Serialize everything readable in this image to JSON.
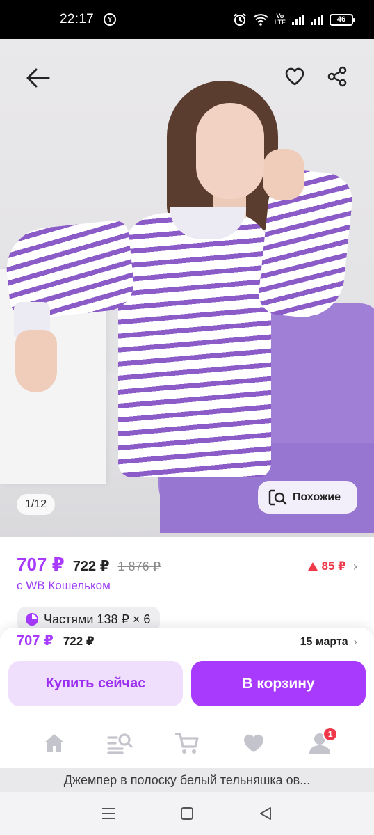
{
  "status_bar": {
    "time": "22:17",
    "notification_icon": "Y",
    "volte_top": "Vo",
    "volte_bottom": "LTE",
    "battery": "46"
  },
  "product": {
    "image_counter": "1/12",
    "similar_label": "Похожие",
    "price_wallet": "707 ₽",
    "price_regular": "722 ₽",
    "price_old": "1 876 ₽",
    "price_drop": "85 ₽",
    "wallet_note": "с WB Кошельком",
    "installments": "Частями 138 ₽ × 6"
  },
  "sheet": {
    "price_wallet": "707 ₽",
    "price_regular": "722 ₽",
    "delivery_date": "15 марта",
    "buy_now_label": "Купить сейчас",
    "add_to_cart_label": "В корзину"
  },
  "tabbar": {
    "cart_badge": "1"
  },
  "product_title": "Джемпер в полоску белый тельняшка ов...",
  "colors": {
    "accent": "#a73afd",
    "price_drop": "#f0384b",
    "buy_now_bg": "#f0defd"
  }
}
